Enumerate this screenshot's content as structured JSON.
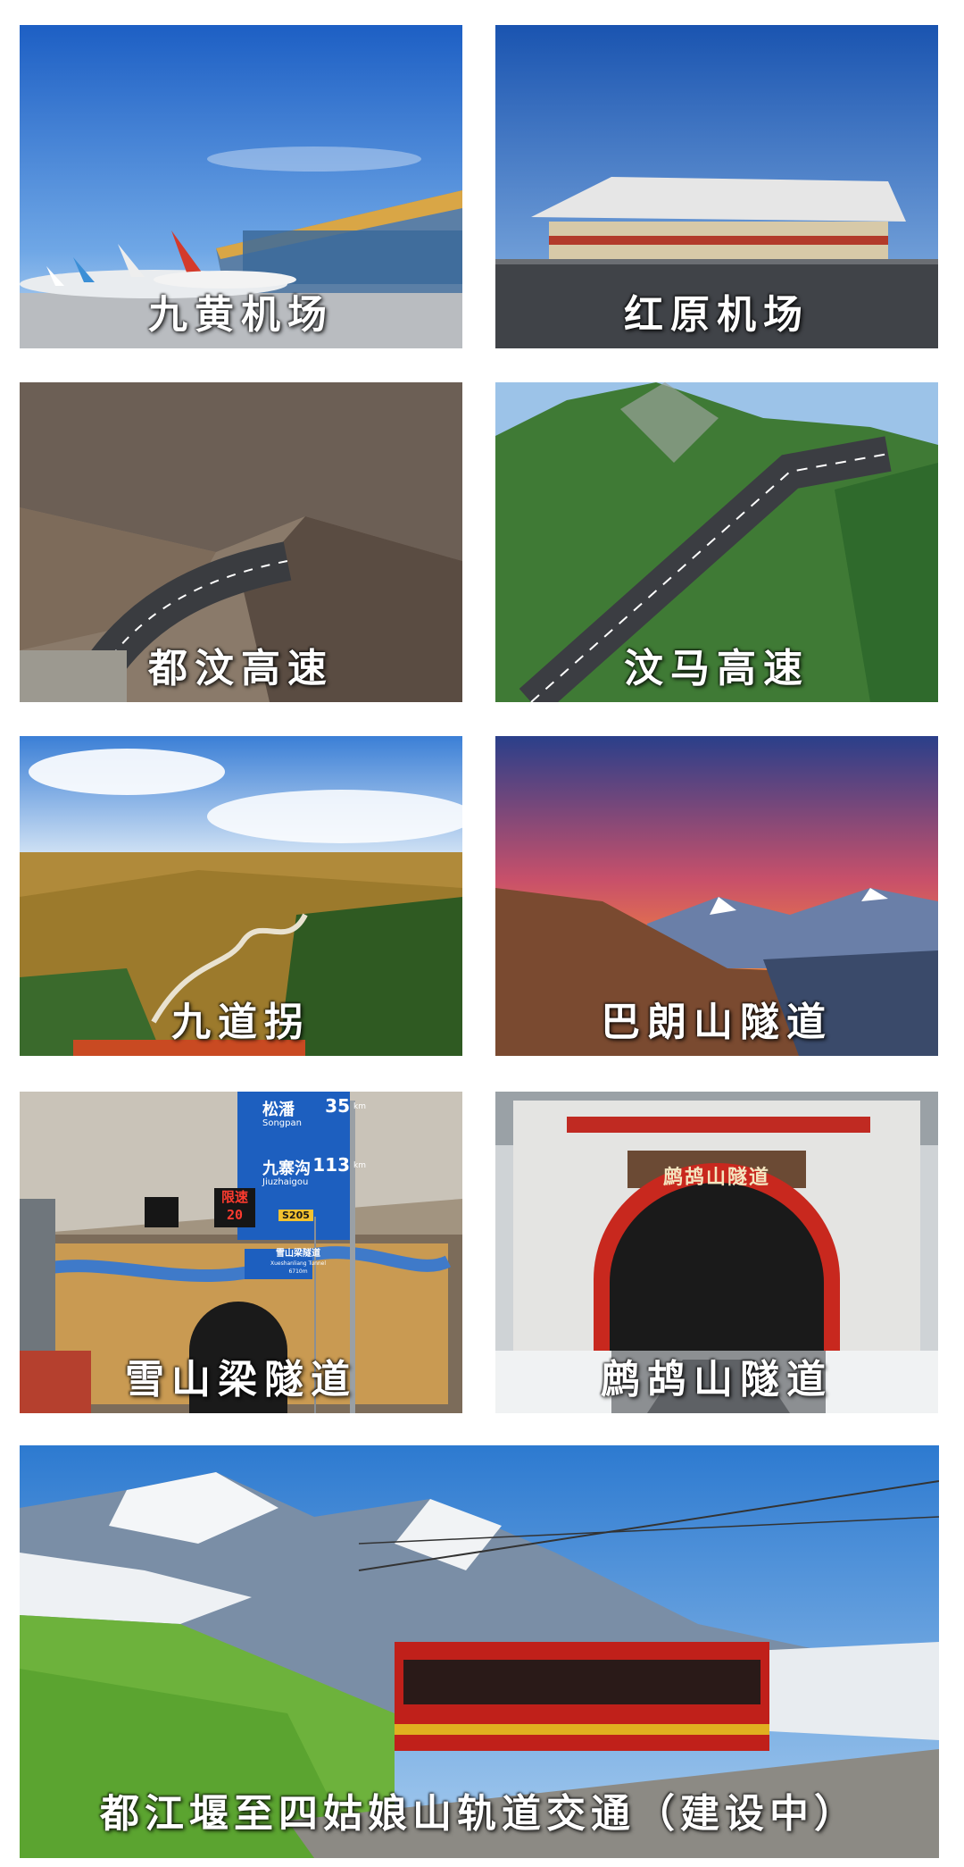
{
  "tiles": [
    {
      "caption": "九黄机场"
    },
    {
      "caption": "红原机场"
    },
    {
      "caption": "都汶高速"
    },
    {
      "caption": "汶马高速"
    },
    {
      "caption": "九道拐"
    },
    {
      "caption": "巴朗山隧道"
    },
    {
      "caption": "雪山梁隧道"
    },
    {
      "caption": "鹧鸪山隧道"
    },
    {
      "caption": "都江堰至四姑娘山轨道交通（建设中）"
    }
  ],
  "signs": {
    "songpan_label": "松潘",
    "songpan_pinyin": "Songpan",
    "songpan_km": "35",
    "jiuzhaigou_label": "九寨沟",
    "jiuzhaigou_pinyin": "Jiuzhaigou",
    "jiuzhaigou_km": "113",
    "km_unit": "km",
    "route_code": "S205",
    "speed_limit_label": "限速",
    "speed_limit_value": "20",
    "tunnel_sign_cn": "雪山梁隧道",
    "tunnel_sign_en": "Xueshanliang Tunnel",
    "tunnel_sign_len": "6710m",
    "zhegu_portal_name": "鹧鸪山隧道"
  },
  "colors": {
    "caption_text": "#ffffff",
    "sign_blue": "#1d5fbf",
    "tunnel_red": "#c8281e",
    "train_red": "#c0201a"
  }
}
